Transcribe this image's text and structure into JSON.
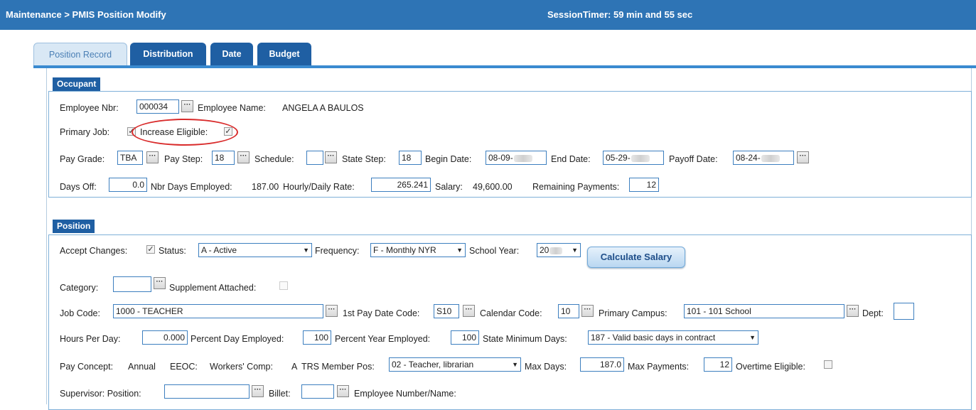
{
  "header": {
    "breadcrumb": "Maintenance > PMIS Position Modify",
    "session_timer": "SessionTimer: 59 min and 55 sec"
  },
  "tabs": [
    {
      "label": "Position Record",
      "active": true
    },
    {
      "label": "Distribution",
      "active": false
    },
    {
      "label": "Date",
      "active": false
    },
    {
      "label": "Budget",
      "active": false
    }
  ],
  "occupant": {
    "section_title": "Occupant",
    "employee_nbr_label": "Employee Nbr:",
    "employee_nbr_value": "000034",
    "employee_name_label": "Employee Name:",
    "employee_name_value": "ANGELA A BAULOS",
    "primary_job_label": "Primary Job:",
    "primary_job_checked": true,
    "increase_eligible_label": "Increase Eligible:",
    "increase_eligible_checked": true,
    "pay_grade_label": "Pay Grade:",
    "pay_grade_value": "TBA",
    "pay_step_label": "Pay Step:",
    "pay_step_value": "18",
    "schedule_label": "Schedule:",
    "schedule_value": "",
    "state_step_label": "State Step:",
    "state_step_value": "18",
    "begin_date_label": "Begin Date:",
    "begin_date_value": "08-09-",
    "end_date_label": "End Date:",
    "end_date_value": "05-29-",
    "payoff_date_label": "Payoff Date:",
    "payoff_date_value": "08-24-",
    "days_off_label": "Days Off:",
    "days_off_value": "0.0",
    "nbr_days_label": "Nbr Days Employed:",
    "nbr_days_value": "187.00",
    "rate_label": "Hourly/Daily Rate:",
    "rate_value": "265.241",
    "salary_label": "Salary:",
    "salary_value": "49,600.00",
    "remaining_label": "Remaining Payments:",
    "remaining_value": "12"
  },
  "position": {
    "section_title": "Position",
    "accept_changes_label": "Accept Changes:",
    "accept_changes_checked": true,
    "status_label": "Status:",
    "status_value": "A - Active",
    "frequency_label": "Frequency:",
    "frequency_value": "F - Monthly NYR",
    "school_year_label": "School Year:",
    "school_year_value": "20",
    "calc_button": "Calculate Salary",
    "category_label": "Category:",
    "category_value": "",
    "supplement_label": "Supplement Attached:",
    "supplement_checked": false,
    "job_code_label": "Job Code:",
    "job_code_value": "1000 - TEACHER",
    "first_pay_label": "1st Pay Date Code:",
    "first_pay_value": "S10",
    "calendar_label": "Calendar Code:",
    "calendar_value": "10",
    "campus_label": "Primary Campus:",
    "campus_value": "101 - 101 School",
    "dept_label": "Dept:",
    "dept_value": "",
    "hours_label": "Hours Per Day:",
    "hours_value": "0.000",
    "pct_day_label": "Percent Day Employed:",
    "pct_day_value": "100",
    "pct_year_label": "Percent Year Employed:",
    "pct_year_value": "100",
    "state_min_label": "State Minimum Days:",
    "state_min_value": "187 - Valid basic days in contract",
    "pay_concept_label": "Pay Concept:",
    "pay_concept_value": "Annual",
    "eeoc_label": "EEOC:",
    "workers_comp_label": "Workers' Comp:",
    "workers_comp_value": "A",
    "trs_label": "TRS Member Pos:",
    "trs_value": "02 - Teacher, librarian",
    "max_days_label": "Max Days:",
    "max_days_value": "187.0",
    "max_payments_label": "Max Payments:",
    "max_payments_value": "12",
    "overtime_label": "Overtime Eligible:",
    "overtime_checked": false,
    "supervisor_label": "Supervisor: Position:",
    "supervisor_value": "",
    "billet_label": "Billet:",
    "billet_value": "",
    "emp_num_name_label": "Employee Number/Name:"
  },
  "colors": {
    "header_bg": "#2e74b5",
    "tab_dark": "#1f5fa3",
    "highlight_circle": "#d92b2b"
  }
}
